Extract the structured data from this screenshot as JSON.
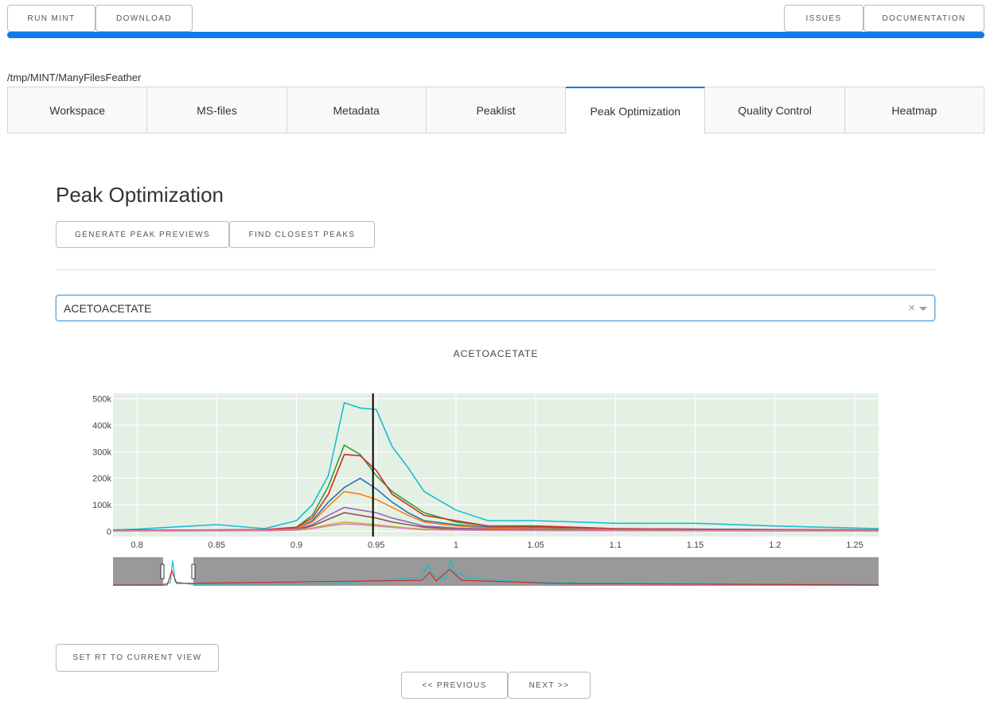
{
  "header": {
    "run_label": "RUN MINT",
    "download_label": "DOWNLOAD",
    "issues_label": "ISSUES",
    "documentation_label": "DOCUMENTATION",
    "progress": 1.0,
    "progress_color": "#0d7be8"
  },
  "workspace_path": "/tmp/MINT/ManyFilesFeather",
  "tabs": [
    {
      "label": "Workspace",
      "active": false
    },
    {
      "label": "MS-files",
      "active": false
    },
    {
      "label": "Metadata",
      "active": false
    },
    {
      "label": "Peaklist",
      "active": false
    },
    {
      "label": "Peak Optimization",
      "active": true
    },
    {
      "label": "Quality Control",
      "active": false
    },
    {
      "label": "Heatmap",
      "active": false
    }
  ],
  "page": {
    "title": "Peak Optimization",
    "generate_label": "GENERATE PEAK PREVIEWS",
    "find_label": "FIND CLOSEST PEAKS",
    "set_rt_label": "SET RT TO CURRENT VIEW",
    "previous_label": "<< PREVIOUS",
    "next_label": "NEXT >>"
  },
  "selector": {
    "value": "ACETOACETATE",
    "clear_icon": "close-icon",
    "arrow_icon": "chevron-down-icon"
  },
  "chart_data": {
    "type": "line",
    "title": "ACETOACETATE",
    "xlim": [
      0.785,
      1.265
    ],
    "ylim": [
      -20000,
      520000
    ],
    "x_ticks": [
      "0.8",
      "0.85",
      "0.9",
      "0.95",
      "1",
      "1.05",
      "1.1",
      "1.15",
      "1.2",
      "1.25"
    ],
    "y_ticks": [
      "0",
      "100k",
      "200k",
      "300k",
      "400k",
      "500k"
    ],
    "vertical_marker_x": 0.948,
    "grid": true,
    "plot_bg": "#e5f0e5",
    "rangeslider": true,
    "x": [
      0.785,
      0.8,
      0.85,
      0.88,
      0.9,
      0.91,
      0.92,
      0.93,
      0.94,
      0.95,
      0.96,
      0.97,
      0.98,
      1.0,
      1.02,
      1.05,
      1.1,
      1.15,
      1.2,
      1.265
    ],
    "series": [
      {
        "color": "#17becf",
        "values": [
          5000,
          8000,
          25000,
          10000,
          40000,
          100000,
          210000,
          485000,
          465000,
          460000,
          320000,
          240000,
          150000,
          80000,
          40000,
          40000,
          30000,
          30000,
          20000,
          10000
        ]
      },
      {
        "color": "#2ca02c",
        "values": [
          3000,
          4000,
          5000,
          6000,
          15000,
          60000,
          170000,
          325000,
          290000,
          210000,
          150000,
          110000,
          70000,
          35000,
          20000,
          15000,
          10000,
          8000,
          6000,
          5000
        ]
      },
      {
        "color": "#d62728",
        "values": [
          3000,
          4000,
          5000,
          6000,
          15000,
          50000,
          140000,
          290000,
          285000,
          230000,
          140000,
          100000,
          60000,
          40000,
          20000,
          20000,
          10000,
          8000,
          6000,
          5000
        ]
      },
      {
        "color": "#1f77b4",
        "values": [
          2000,
          3000,
          4000,
          5000,
          10000,
          40000,
          110000,
          165000,
          200000,
          160000,
          110000,
          70000,
          40000,
          25000,
          15000,
          10000,
          8000,
          6000,
          5000,
          4000
        ]
      },
      {
        "color": "#ff7f0e",
        "values": [
          2000,
          3000,
          4000,
          5000,
          10000,
          35000,
          95000,
          150000,
          140000,
          120000,
          90000,
          60000,
          35000,
          20000,
          12000,
          9000,
          7000,
          5000,
          4000,
          3000
        ]
      },
      {
        "color": "#9467bd",
        "values": [
          2000,
          2500,
          3000,
          4000,
          8000,
          25000,
          60000,
          90000,
          80000,
          70000,
          50000,
          35000,
          20000,
          12000,
          8000,
          6000,
          5000,
          4000,
          3000,
          2000
        ]
      },
      {
        "color": "#8c564b",
        "values": [
          1500,
          2000,
          2500,
          3000,
          6000,
          20000,
          45000,
          70000,
          60000,
          50000,
          35000,
          25000,
          15000,
          8000,
          6000,
          5000,
          4000,
          3000,
          2000,
          1500
        ]
      },
      {
        "color": "#bcbd22",
        "values": [
          1000,
          1500,
          2000,
          2500,
          5000,
          12000,
          25000,
          35000,
          30000,
          25000,
          18000,
          12000,
          8000,
          5000,
          4000,
          3000,
          2500,
          2000,
          1500,
          1000
        ]
      },
      {
        "color": "#e377c2",
        "values": [
          1000,
          1200,
          1500,
          2000,
          4000,
          10000,
          20000,
          28000,
          25000,
          20000,
          15000,
          10000,
          6000,
          4000,
          3000,
          2500,
          2000,
          1500,
          1200,
          1000
        ]
      }
    ]
  }
}
